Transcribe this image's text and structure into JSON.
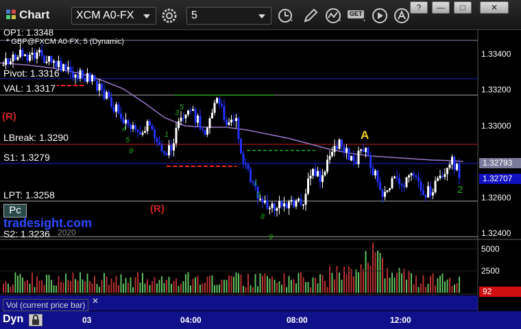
{
  "toolbar": {
    "title": "Chart",
    "symbol": "XCM A0-FX",
    "interval": "5",
    "get_label": "GET",
    "win_buttons": [
      "?",
      "—",
      "□",
      "✕"
    ]
  },
  "chart": {
    "subtitle": "* GBP@FXCM A0-FX, 5 (Dynamic)",
    "top_cut_label": "OP1: 1.3348",
    "levels": {
      "pivot": "Pivot: 1.3316",
      "val": "VAL: 1.3317",
      "lbreak": "LBreak: 1.3290",
      "s1": "S1: 1.3279",
      "lpt": "LPT: 1.3258",
      "s2": "S2: 1.3236"
    },
    "markers": {
      "r_left": "(R)",
      "r_mid": "(R)",
      "a": "A",
      "two": "2",
      "pc": "Pc",
      "watermark": "tradesight.com",
      "watermark_year": "2020"
    },
    "price_axis": [
      "1.33400",
      "1.33200",
      "1.33000",
      "1.32600",
      "1.32400"
    ],
    "price_tags": [
      {
        "text": "1.32793",
        "color": "#7a7a9a"
      },
      {
        "text": "1.32707",
        "color": "#1010c0"
      }
    ],
    "volume_axis": [
      "5000",
      "2500"
    ],
    "volume_tag": "92",
    "volume_label": "Vol (current price bar)",
    "close_x": "✕",
    "time_labels": [
      "03",
      "04:00",
      "08:00",
      "12:00"
    ],
    "dyn_label": "Dyn"
  }
}
